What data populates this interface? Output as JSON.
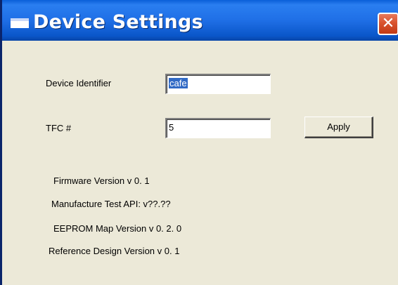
{
  "window": {
    "title": "Device Settings",
    "close_label": "✕"
  },
  "fields": {
    "device_identifier": {
      "label": "Device Identifier",
      "value": "cafe"
    },
    "tfc": {
      "label": "TFC #",
      "value": "5"
    }
  },
  "buttons": {
    "apply": "Apply"
  },
  "info": {
    "firmware": "Firmware Version v 0. 1",
    "manufacture_test_api": "Manufacture Test API: v??.??",
    "eeprom_map": "EEPROM Map Version v 0. 2. 0",
    "reference_design": "Reference Design Version v 0. 1"
  },
  "colors": {
    "titlebar": "#1f6fe6",
    "window_bg": "#ece9d8",
    "close_button": "#d9532e",
    "selection": "#316ac5"
  }
}
